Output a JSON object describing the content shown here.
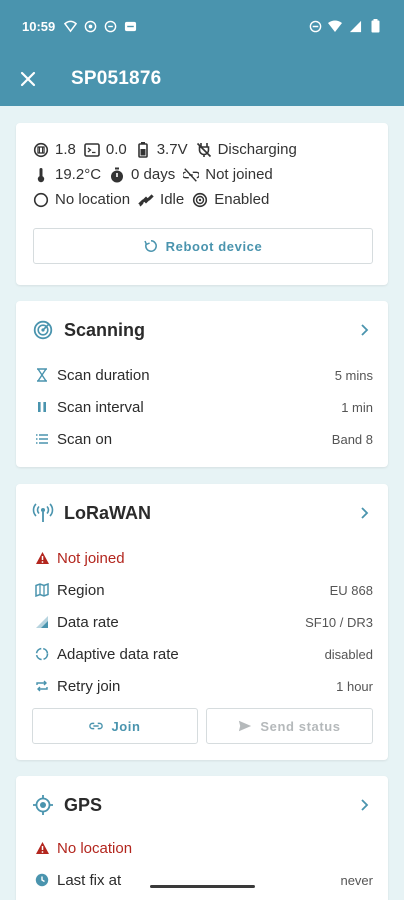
{
  "status_bar": {
    "time": "10:59"
  },
  "header": {
    "title": "SP051876"
  },
  "device": {
    "stats": {
      "firmware": "1.8",
      "counter": "0.0",
      "battery": "3.7V",
      "charging": "Discharging",
      "temperature": "19.2°C",
      "uptime": "0 days",
      "join_state": "Not joined",
      "location": "No location",
      "activity": "Idle",
      "scanning": "Enabled"
    },
    "reboot_label": "Reboot device"
  },
  "scanning": {
    "title": "Scanning",
    "rows": [
      {
        "label": "Scan duration",
        "value": "5 mins"
      },
      {
        "label": "Scan interval",
        "value": "1 min"
      },
      {
        "label": "Scan on",
        "value": "Band 8"
      }
    ]
  },
  "lorawan": {
    "title": "LoRaWAN",
    "status": "Not joined",
    "rows": [
      {
        "label": "Region",
        "value": "EU 868"
      },
      {
        "label": "Data rate",
        "value": "SF10 / DR3"
      },
      {
        "label": "Adaptive data rate",
        "value": "disabled"
      },
      {
        "label": "Retry join",
        "value": "1 hour"
      }
    ],
    "join_label": "Join",
    "send_label": "Send status"
  },
  "gps": {
    "title": "GPS",
    "status": "No location",
    "rows": [
      {
        "label": "Last fix at",
        "value": "never"
      }
    ]
  },
  "colors": {
    "appbar": "#4a94ae",
    "accent": "#4a94ae",
    "error": "#b3261e",
    "background": "#e7f3f5"
  }
}
